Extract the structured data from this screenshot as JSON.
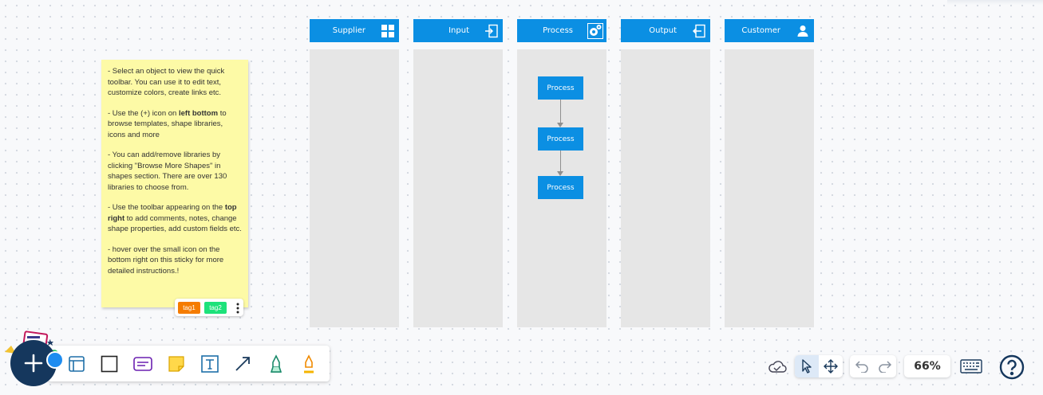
{
  "columns": [
    {
      "label": "Supplier",
      "icon": "grid-icon"
    },
    {
      "label": "Input",
      "icon": "enter-icon"
    },
    {
      "label": "Process",
      "icon": "gear-icon"
    },
    {
      "label": "Output",
      "icon": "exit-icon"
    },
    {
      "label": "Customer",
      "icon": "person-icon"
    }
  ],
  "process_boxes": [
    "Process",
    "Process",
    "Process"
  ],
  "sticky": {
    "paragraphs": [
      "- Select an object to view the quick toolbar. You can use it to edit text, customize colors, create links etc.",
      "- Use the (+) icon on |left bottom| to browse templates, shape libraries, icons and more",
      "- You can add/remove libraries by clicking \"Browse More Shapes\" in shapes section. There are over 130 libraries to choose from.",
      "- Use the toolbar appearing on the |top right| to add comments, notes, change shape properties, add custom fields etc.",
      "- hover over the small icon on the bottom right on this sticky for more detailed instructions.!"
    ],
    "p1": "- Select an object to view the quick toolbar. You can use it to edit text, customize colors, create links etc.",
    "p2_pre": "- Use the (+) icon on ",
    "p2_bold": "left bottom",
    "p2_post": " to browse templates, shape libraries, icons and more",
    "p3": "- You can add/remove libraries by clicking \"Browse More Shapes\" in shapes section. There are over 130 libraries to choose from.",
    "p4_pre": "- Use the toolbar appearing on the ",
    "p4_bold": "top right",
    "p4_post": " to add comments, notes, change shape properties, add custom fields etc.",
    "p5": "- hover over the small icon on the bottom right on this sticky for more detailed instructions.!",
    "tags": [
      {
        "label": "tag1",
        "color": "#f57c00"
      },
      {
        "label": "tag2",
        "color": "#1de27a"
      }
    ]
  },
  "toolbar": {
    "tools": [
      "frame-icon",
      "rectangle-icon",
      "card-icon",
      "sticky-note-icon",
      "text-icon",
      "arrow-icon",
      "marker-icon",
      "highlighter-icon"
    ]
  },
  "controls": {
    "zoom": "66%",
    "icons": [
      "cloud-save-icon",
      "select-pointer-icon",
      "pan-move-icon",
      "undo-icon",
      "redo-icon",
      "keyboard-icon",
      "help-icon"
    ]
  },
  "colors": {
    "accent": "#0b8fe3",
    "sticky": "#fdfaa6",
    "column_bg": "#e6e6e6",
    "fab": "#15375d"
  }
}
